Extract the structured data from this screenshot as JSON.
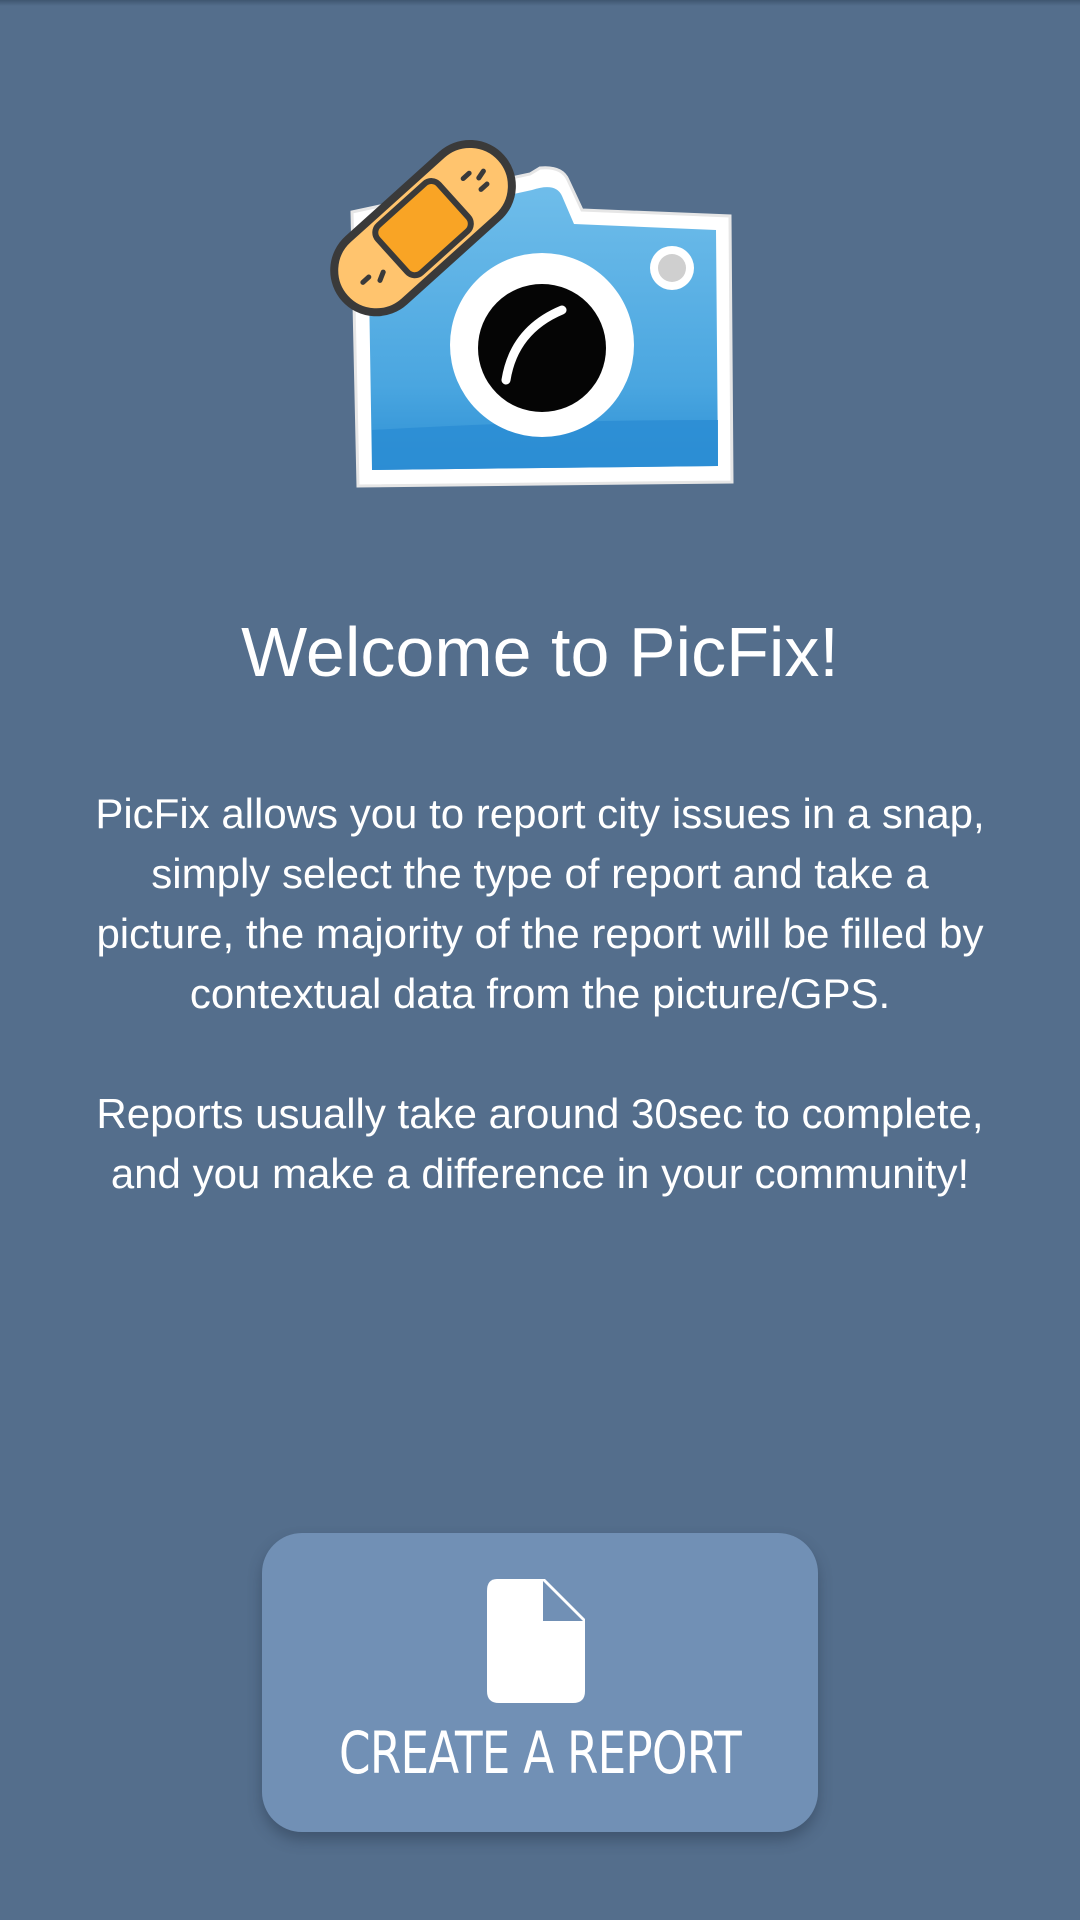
{
  "app": {
    "name": "PicFix"
  },
  "welcome": {
    "title": "Welcome to PicFix!",
    "paragraph_1": "PicFix allows you to report city issues in a snap, simply select the type of report and take a picture, the majority of the report will be filled by contextual data from the picture/GPS.",
    "paragraph_2_line_1": "Reports usually take around 30sec to complete,",
    "paragraph_2_line_2": "and you make a difference in your community!"
  },
  "actions": {
    "create_report_label": "CREATE A REPORT",
    "create_report_icon": "document-icon"
  },
  "colors": {
    "background": "#546e8c",
    "button": "#7190b5",
    "camera_blue": "#4ea9e2",
    "bandage": "#ffc46e",
    "bandage_pad": "#f9a425"
  }
}
